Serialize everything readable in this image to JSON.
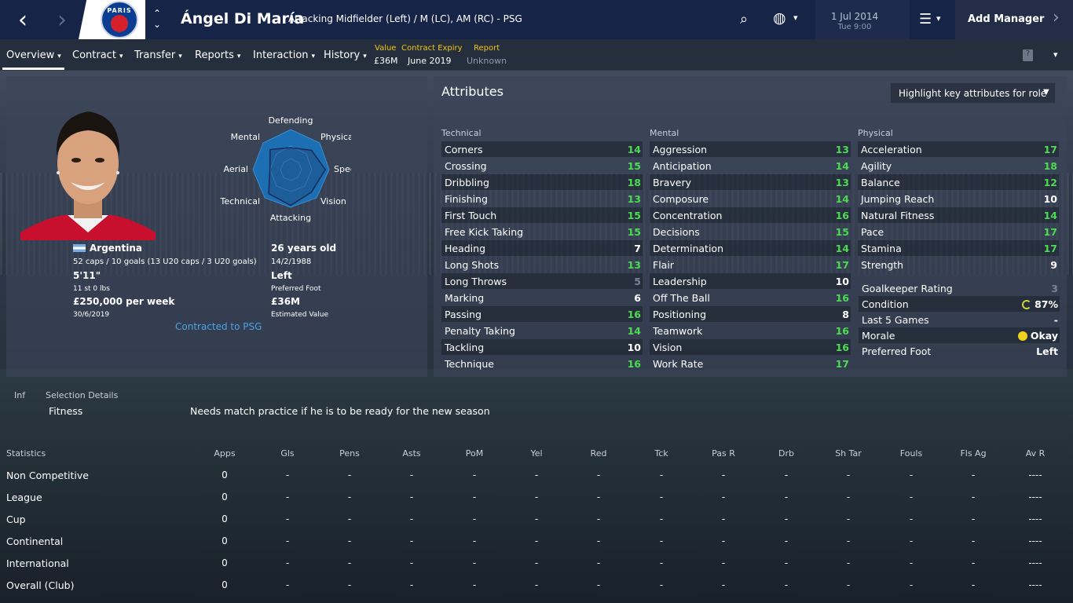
{
  "header": {
    "player_name": "Ángel Di María",
    "position": "Attacking Midfielder (Left) / M (LC), AM (RC) - PSG",
    "date": "1 Jul 2014",
    "time": "Tue 9:00",
    "add_manager": "Add Manager",
    "crest_text": "PARIS"
  },
  "subnav": {
    "tabs": [
      "Overview",
      "Contract",
      "Transfer",
      "Reports",
      "Interaction",
      "History"
    ],
    "value_label": "Value",
    "value": "£36M",
    "expiry_label": "Contract Expiry",
    "expiry": "June 2019",
    "report_label": "Report",
    "report": "Unknown"
  },
  "profile": {
    "nation": "Argentina",
    "caps": "52 caps / 10 goals (13 U20 caps / 3 U20 goals)",
    "height": "5'11\"",
    "weight": "11 st 0 lbs",
    "wage": "£250,000 per week",
    "contract_end": "30/6/2019",
    "age": "26 years old",
    "dob": "14/2/1988",
    "foot": "Left",
    "foot_label": "Preferred Foot",
    "est_value": "£36M",
    "est_value_label": "Estimated Value",
    "contracted": "Contracted to PSG"
  },
  "radar": {
    "labels": [
      "Defending",
      "Physical",
      "Speed",
      "Vision",
      "Attacking",
      "Technical",
      "Aerial",
      "Mental"
    ],
    "levels": [
      0.55,
      0.72,
      0.9,
      0.8,
      0.95,
      0.85,
      0.55,
      0.75
    ]
  },
  "attributes": {
    "title": "Attributes",
    "highlight_btn": "Highlight key attributes for role",
    "technical_label": "Technical",
    "mental_label": "Mental",
    "physical_label": "Physical",
    "technical": [
      [
        "Corners",
        "14"
      ],
      [
        "Crossing",
        "15"
      ],
      [
        "Dribbling",
        "18"
      ],
      [
        "Finishing",
        "13"
      ],
      [
        "First Touch",
        "15"
      ],
      [
        "Free Kick Taking",
        "15"
      ],
      [
        "Heading",
        "7"
      ],
      [
        "Long Shots",
        "13"
      ],
      [
        "Long Throws",
        "5"
      ],
      [
        "Marking",
        "6"
      ],
      [
        "Passing",
        "16"
      ],
      [
        "Penalty Taking",
        "14"
      ],
      [
        "Tackling",
        "10"
      ],
      [
        "Technique",
        "16"
      ]
    ],
    "mental": [
      [
        "Aggression",
        "13"
      ],
      [
        "Anticipation",
        "14"
      ],
      [
        "Bravery",
        "13"
      ],
      [
        "Composure",
        "14"
      ],
      [
        "Concentration",
        "16"
      ],
      [
        "Decisions",
        "15"
      ],
      [
        "Determination",
        "14"
      ],
      [
        "Flair",
        "17"
      ],
      [
        "Leadership",
        "10"
      ],
      [
        "Off The Ball",
        "16"
      ],
      [
        "Positioning",
        "8"
      ],
      [
        "Teamwork",
        "16"
      ],
      [
        "Vision",
        "16"
      ],
      [
        "Work Rate",
        "17"
      ]
    ],
    "physical": [
      [
        "Acceleration",
        "17"
      ],
      [
        "Agility",
        "18"
      ],
      [
        "Balance",
        "12"
      ],
      [
        "Jumping Reach",
        "10"
      ],
      [
        "Natural Fitness",
        "14"
      ],
      [
        "Pace",
        "17"
      ],
      [
        "Stamina",
        "17"
      ],
      [
        "Strength",
        "9"
      ]
    ],
    "extra": [
      [
        "Goalkeeper Rating",
        "3"
      ],
      [
        "Condition",
        "87%"
      ],
      [
        "Last 5 Games",
        "-"
      ],
      [
        "Morale",
        "Okay"
      ],
      [
        "Preferred Foot",
        "Left"
      ]
    ],
    "colors": {
      "high": "#4cdb52",
      "mid": "#ffffff",
      "low": "#7c8495"
    }
  },
  "selection": {
    "inf_label": "Inf",
    "label": "Selection Details",
    "fitness_label": "Fitness",
    "fitness_text": "Needs match practice if he is to be ready for the new season"
  },
  "stats": {
    "headers": [
      "Statistics",
      "Apps",
      "Gls",
      "Pens",
      "Asts",
      "PoM",
      "Yel",
      "Red",
      "Tck",
      "Pas R",
      "Drb",
      "Sh Tar",
      "Fouls",
      "Fls Ag",
      "Av R"
    ],
    "rows": [
      [
        "Non Competitive",
        "0",
        "-",
        "-",
        "-",
        "-",
        "-",
        "-",
        "-",
        "-",
        "-",
        "-",
        "-",
        "-",
        "----"
      ],
      [
        "League",
        "0",
        "-",
        "-",
        "-",
        "-",
        "-",
        "-",
        "-",
        "-",
        "-",
        "-",
        "-",
        "-",
        "----"
      ],
      [
        "Cup",
        "0",
        "-",
        "-",
        "-",
        "-",
        "-",
        "-",
        "-",
        "-",
        "-",
        "-",
        "-",
        "-",
        "----"
      ],
      [
        "Continental",
        "0",
        "-",
        "-",
        "-",
        "-",
        "-",
        "-",
        "-",
        "-",
        "-",
        "-",
        "-",
        "-",
        "----"
      ],
      [
        "International",
        "0",
        "-",
        "-",
        "-",
        "-",
        "-",
        "-",
        "-",
        "-",
        "-",
        "-",
        "-",
        "-",
        "----"
      ],
      [
        "Overall (Club)",
        "0",
        "-",
        "-",
        "-",
        "-",
        "-",
        "-",
        "-",
        "-",
        "-",
        "-",
        "-",
        "-",
        "----"
      ]
    ]
  }
}
